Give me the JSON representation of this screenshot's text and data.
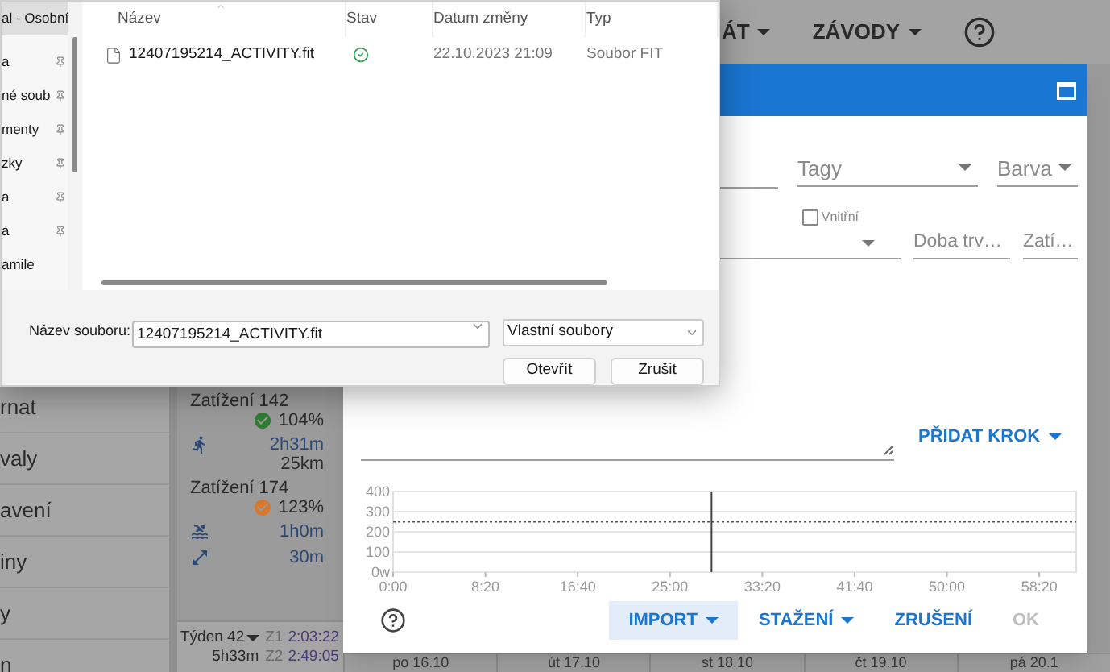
{
  "app": {
    "nav": [
      {
        "label": "ÁT",
        "kind": "menu"
      },
      {
        "label": "ZÁVODY",
        "kind": "menu"
      },
      {
        "kind": "help"
      }
    ],
    "sidebar": {
      "items": [
        "rnat",
        "valy",
        "avení",
        "iny",
        "y",
        "n"
      ]
    },
    "calendar": {
      "entries": [
        {
          "kind": "load",
          "text": "Zatížení 142",
          "score": "104%",
          "color": "#2e7d32"
        },
        {
          "kind": "run",
          "duration": "2h31m",
          "distance": "25km"
        },
        {
          "kind": "load",
          "text": "Zatížení 174",
          "score": "123%",
          "color": "#d9782b"
        },
        {
          "kind": "swim",
          "duration": "1h0m"
        },
        {
          "kind": "stretch",
          "duration": "30m"
        }
      ],
      "week": {
        "label": "Týden 42",
        "total": "5h33m",
        "zones": [
          {
            "zone": "Z1",
            "time": "2:03:22"
          },
          {
            "zone": "Z2",
            "time": "2:49:05"
          }
        ]
      },
      "dates": [
        "po 16.10",
        "út 17.10",
        "st 18.10",
        "čt 19.10",
        "pá 20.1"
      ]
    }
  },
  "workout_dialog": {
    "tags": {
      "placeholder": "Tagy"
    },
    "color": {
      "placeholder": "Barva"
    },
    "indoor": {
      "label": "Vnitřní",
      "checked": false
    },
    "duration": {
      "placeholder": "Doba trv…"
    },
    "load": {
      "placeholder": "Zatí…"
    },
    "add_step": "PŘIDAT KROK",
    "chart_data": {
      "type": "line",
      "xlim": [
        0,
        3700
      ],
      "ylim": [
        0,
        400
      ],
      "grid": true,
      "xticks": [
        {
          "value": 0,
          "label": "0:00"
        },
        {
          "value": 500,
          "label": "8:20"
        },
        {
          "value": 1000,
          "label": "16:40"
        },
        {
          "value": 1500,
          "label": "25:00"
        },
        {
          "value": 2000,
          "label": "33:20"
        },
        {
          "value": 2500,
          "label": "41:40"
        },
        {
          "value": 3000,
          "label": "50:00"
        },
        {
          "value": 3500,
          "label": "58:20"
        }
      ],
      "yticks": [
        {
          "value": 0,
          "label": "0w"
        },
        100,
        200,
        300,
        400
      ],
      "ref_lines": [
        {
          "axis": "y",
          "value": 250
        },
        {
          "axis": "x",
          "value": 1725
        }
      ]
    },
    "buttons": [
      {
        "label": "IMPORT",
        "kind": "dropdown",
        "highlighted": true,
        "disabled": false
      },
      {
        "label": "STAŽENÍ",
        "kind": "dropdown",
        "highlighted": false,
        "disabled": false
      },
      {
        "label": "ZRUŠENÍ",
        "kind": "plain",
        "highlighted": false,
        "disabled": false
      },
      {
        "label": "OK",
        "kind": "plain",
        "highlighted": false,
        "disabled": true
      }
    ]
  },
  "file_dialog": {
    "nav_items": [
      {
        "label": "al - Osobní",
        "pinned": false,
        "selected": true
      },
      {
        "label": "a",
        "pinned": true,
        "selected": false
      },
      {
        "label": "né soub",
        "pinned": true,
        "selected": false
      },
      {
        "label": "menty",
        "pinned": true,
        "selected": false
      },
      {
        "label": "zky",
        "pinned": true,
        "selected": false
      },
      {
        "label": "a",
        "pinned": true,
        "selected": false
      },
      {
        "label": "a",
        "pinned": true,
        "selected": false
      },
      {
        "label": "amile",
        "pinned": false,
        "selected": false
      }
    ],
    "columns": [
      {
        "label": "Název",
        "sorted": true
      },
      {
        "label": "Stav",
        "sorted": false
      },
      {
        "label": "Datum změny",
        "sorted": false
      },
      {
        "label": "Typ",
        "sorted": false
      }
    ],
    "rows": [
      {
        "name": "12407195214_ACTIVITY.fit",
        "synced": true,
        "modified": "22.10.2023 21:09",
        "type": "Soubor FIT"
      }
    ],
    "file_name": {
      "label": "Název souboru:",
      "value": "12407195214_ACTIVITY.fit"
    },
    "filter": "Vlastní soubory",
    "buttons": [
      "Otevřít",
      "Zrušit"
    ]
  }
}
